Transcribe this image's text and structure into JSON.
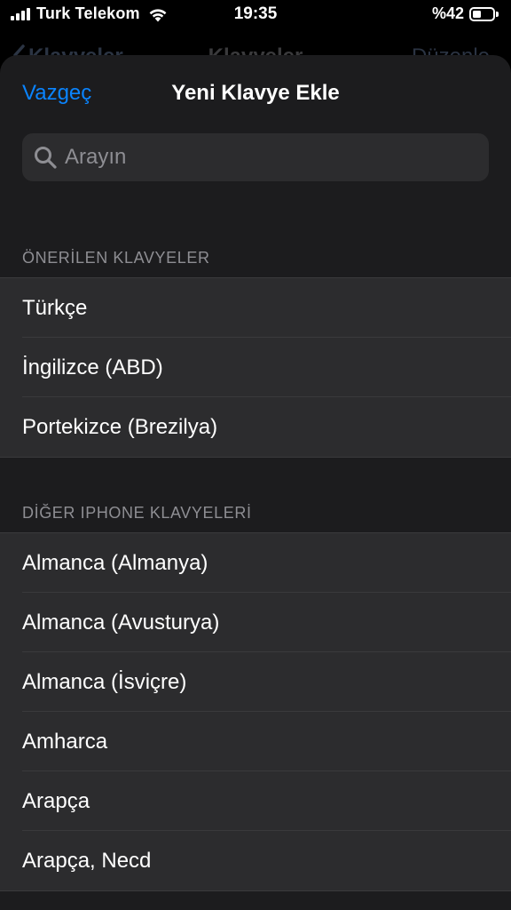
{
  "status_bar": {
    "carrier": "Turk Telekom",
    "time": "19:35",
    "battery_percent": "%42",
    "battery_level": 0.42,
    "icons": [
      "signal-icon",
      "wifi-icon",
      "battery-icon"
    ]
  },
  "background_nav": {
    "back_label": "Klavyeler",
    "title": "Klavyeler",
    "edit_label": "Düzenle"
  },
  "sheet": {
    "cancel_label": "Vazgeç",
    "title": "Yeni Klavye Ekle",
    "search": {
      "placeholder": "Arayın",
      "value": ""
    }
  },
  "sections": [
    {
      "header": "ÖNERİLEN KLAVYELER",
      "items": [
        "Türkçe",
        "İngilizce (ABD)",
        "Portekizce (Brezilya)"
      ]
    },
    {
      "header": "DİĞER IPHONE KLAVYELERİ",
      "items": [
        "Almanca (Almanya)",
        "Almanca (Avusturya)",
        "Almanca (İsviçre)",
        "Amharca",
        "Arapça",
        "Arapça, Necd"
      ]
    }
  ],
  "colors": {
    "accent": "#0a84ff",
    "background": "#000000",
    "sheet": "#1c1c1e",
    "cell": "#2c2c2e",
    "secondary_text": "#8e8e93"
  }
}
